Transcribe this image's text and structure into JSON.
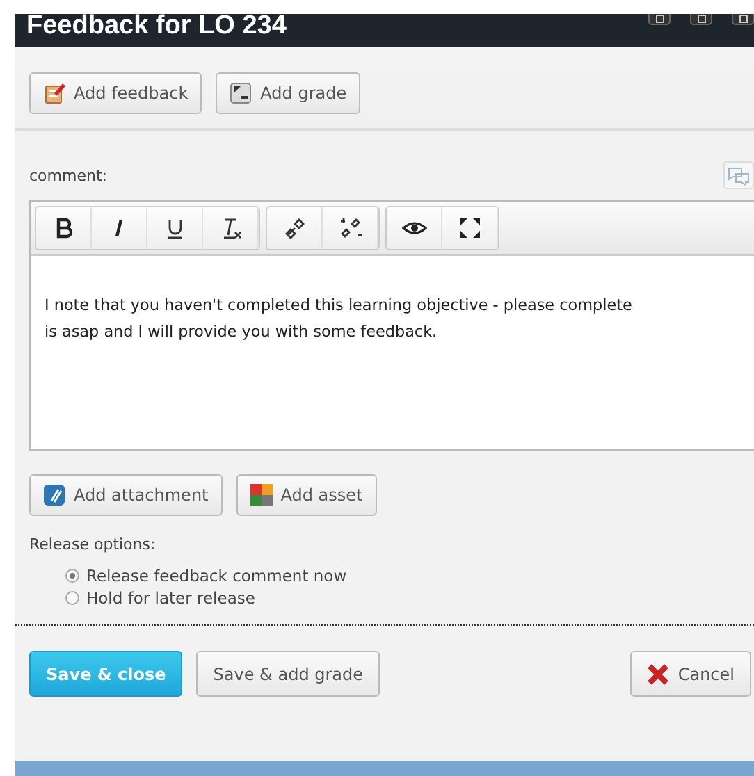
{
  "window": {
    "title": "Feedback for LO 234"
  },
  "top_buttons": [
    {
      "label": "Add feedback",
      "kind": "feedback"
    },
    {
      "label": "Add grade",
      "kind": "grade"
    }
  ],
  "comment": {
    "label": "comment:",
    "value_lines": [
      "I note that you haven't completed this learning objective - please complete",
      "is asap and I will provide you with some feedback."
    ]
  },
  "attach_buttons": [
    {
      "label": "Add attachment",
      "kind": "attachment"
    },
    {
      "label": "Add asset",
      "kind": "asset"
    }
  ],
  "release": {
    "label": "Release options:",
    "options": [
      {
        "label": "Release feedback comment now",
        "selected": true
      },
      {
        "label": "Hold for later release",
        "selected": false
      }
    ]
  },
  "footer_buttons": [
    {
      "label": "Save & close",
      "kind": "primary"
    },
    {
      "label": "Save & add grade",
      "kind": "default"
    },
    {
      "label": "Cancel",
      "kind": "cancel"
    }
  ]
}
